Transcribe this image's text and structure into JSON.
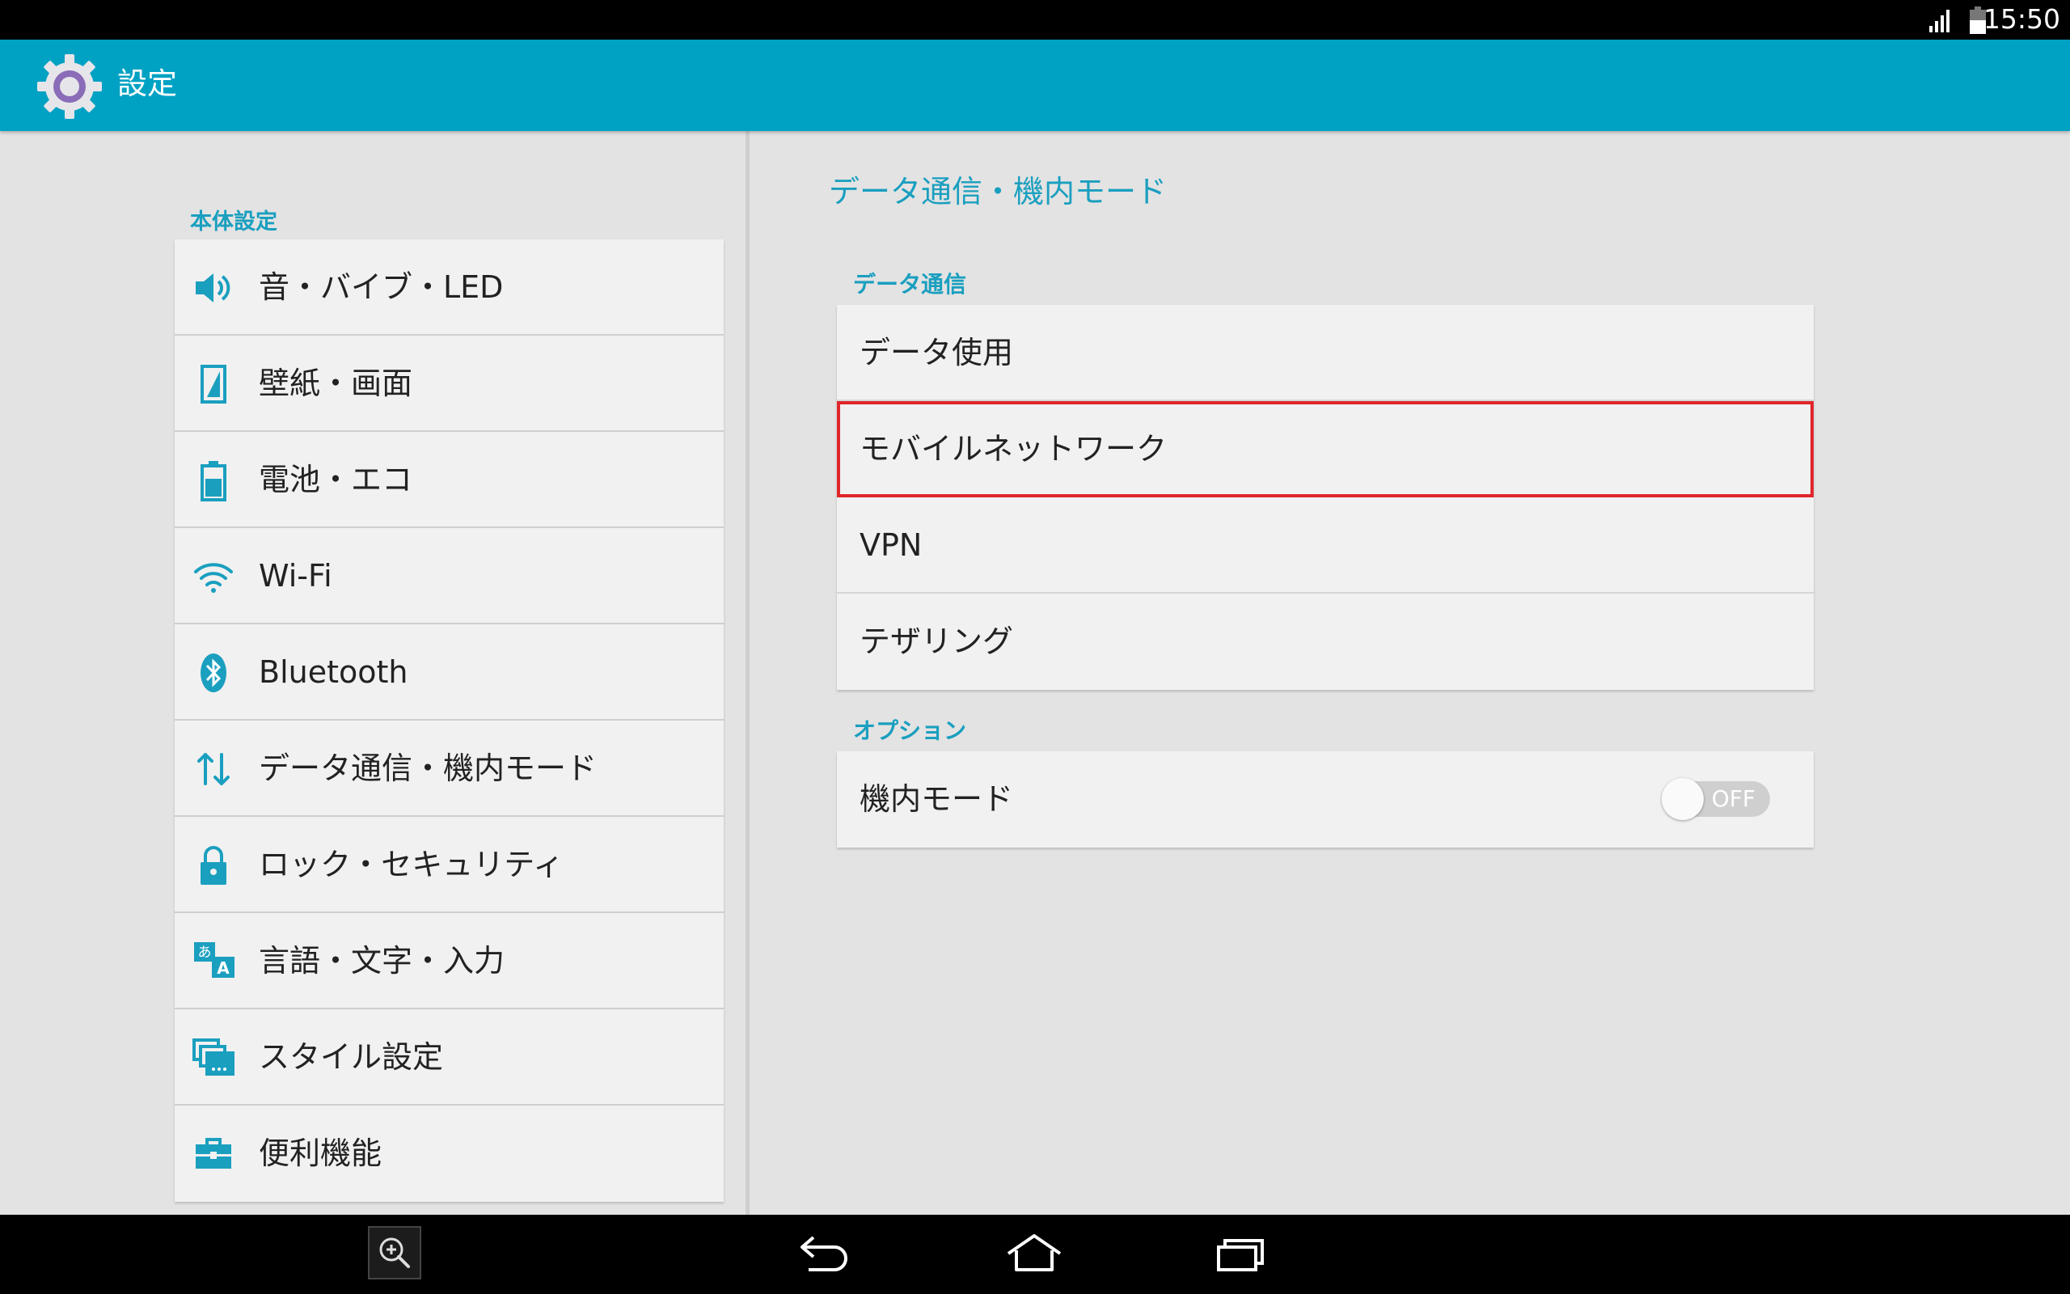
{
  "status_bar": {
    "time": "15:50",
    "icons": [
      "signal-icon",
      "battery-icon"
    ]
  },
  "action_bar": {
    "title": "設定",
    "icon": "settings-gear-icon"
  },
  "left_pane": {
    "section_header": "本体設定",
    "items": [
      {
        "label": "音・バイブ・LED",
        "icon": "speaker-icon"
      },
      {
        "label": "壁紙・画面",
        "icon": "wallpaper-icon"
      },
      {
        "label": "電池・エコ",
        "icon": "battery-eco-icon"
      },
      {
        "label": "Wi-Fi",
        "icon": "wifi-icon"
      },
      {
        "label": "Bluetooth",
        "icon": "bluetooth-icon"
      },
      {
        "label": "データ通信・機内モード",
        "icon": "data-transfer-icon"
      },
      {
        "label": "ロック・セキュリティ",
        "icon": "lock-icon"
      },
      {
        "label": "言語・文字・入力",
        "icon": "language-icon"
      },
      {
        "label": "スタイル設定",
        "icon": "style-icon"
      },
      {
        "label": "便利機能",
        "icon": "toolbox-icon"
      }
    ]
  },
  "right_pane": {
    "title": "データ通信・機内モード",
    "data_section": {
      "header": "データ通信",
      "items": [
        {
          "label": "データ使用"
        },
        {
          "label": "モバイルネットワーク"
        },
        {
          "label": "VPN"
        },
        {
          "label": "テザリング"
        }
      ]
    },
    "options_section": {
      "header": "オプション",
      "airplane_mode": {
        "label": "機内モード",
        "toggle_text": "OFF",
        "enabled": false
      }
    }
  },
  "colors": {
    "accent": "#00a2c3",
    "text_accent": "#1a9fbf",
    "highlight": "#e0262b",
    "background": "#e3e3e3"
  },
  "nav_bar": {
    "icons": [
      "zoom-icon",
      "back-icon",
      "home-icon",
      "recents-icon"
    ]
  }
}
